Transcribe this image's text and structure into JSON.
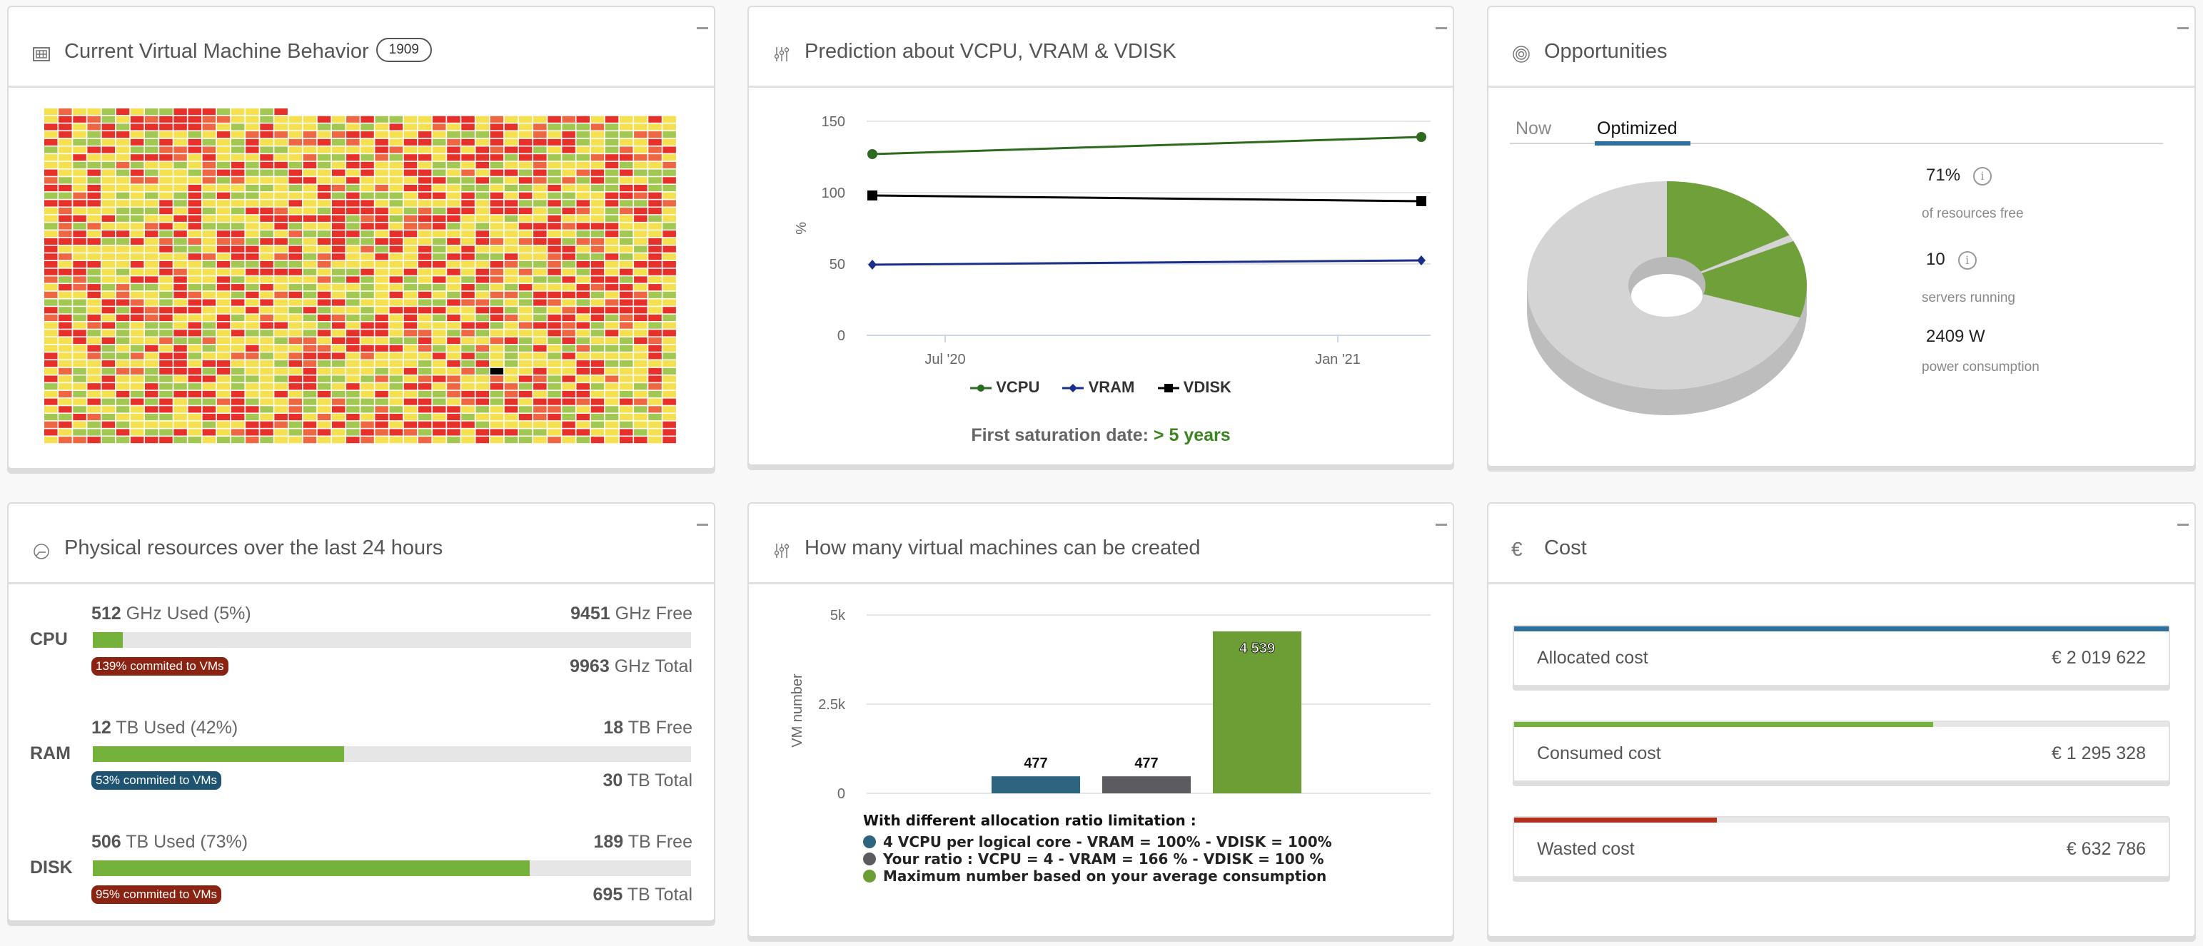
{
  "panels": {
    "vm_behavior": {
      "title": "Current Virtual Machine Behavior",
      "count_badge": "1909",
      "heatmap": {
        "total_cells": 1909,
        "columns": 44,
        "status_colors": {
          "ok": "#a2c852",
          "warning": "#f5e04f",
          "high": "#e8302a",
          "elevated": "#ee6742",
          "selected": "#000000"
        }
      }
    },
    "prediction": {
      "title": "Prediction about VCPU, VRAM & VDISK",
      "saturation_label": "First saturation date:",
      "saturation_value": "> 5 years"
    },
    "opportunities": {
      "title": "Opportunities",
      "tabs": [
        {
          "label": "Now",
          "active": false
        },
        {
          "label": "Optimized",
          "active": true
        }
      ],
      "stats": [
        {
          "value": "71%",
          "label": "of resources free",
          "has_info": true
        },
        {
          "value": "10",
          "label": "servers running",
          "has_info": true
        },
        {
          "value": "2409 W",
          "label": "power consumption",
          "has_info": false
        }
      ]
    },
    "physical": {
      "title": "Physical resources over the last 24 hours",
      "resources": [
        {
          "name": "CPU",
          "used_num": "512",
          "used_text": " GHz Used (5%)",
          "free_num": "9451",
          "free_text": " GHz Free",
          "total_num": "9963",
          "total_text": " GHz Total",
          "used_pct": 5,
          "committed": "139% commited to VMs",
          "committed_color": "#8b2312"
        },
        {
          "name": "RAM",
          "used_num": "12",
          "used_text": " TB Used (42%)",
          "free_num": "18",
          "free_text": " TB Free",
          "total_num": "30",
          "total_text": " TB Total",
          "used_pct": 42,
          "committed": "53% commited to VMs",
          "committed_color": "#1f5372"
        },
        {
          "name": "DISK",
          "used_num": "506",
          "used_text": " TB Used (73%)",
          "free_num": "189",
          "free_text": " TB Free",
          "total_num": "695",
          "total_text": " TB Total",
          "used_pct": 73,
          "committed": "95% commited to VMs",
          "committed_color": "#8b2312"
        }
      ]
    },
    "vm_capacity": {
      "title": "How many virtual machines can be created",
      "legend_title": "With different allocation ratio limitation :",
      "legend": [
        {
          "label": "4 VCPU per logical core - VRAM = 100% - VDISK = 100%",
          "color": "#2d6480"
        },
        {
          "label": "Your ratio : VCPU = 4 - VRAM = 166 % - VDISK = 100 %",
          "color": "#5c5c60"
        },
        {
          "label": "Maximum number based on your average consumption",
          "color": "#6c9e35"
        }
      ]
    },
    "cost": {
      "title": "Cost",
      "items": [
        {
          "label": "Allocated cost",
          "value": "€ 2 019 622",
          "fill_pct": 100,
          "color": "#2e6f9e"
        },
        {
          "label": "Consumed cost",
          "value": "€ 1 295 328",
          "fill_pct": 64,
          "color": "#74b23b"
        },
        {
          "label": "Wasted cost",
          "value": "€ 632 786",
          "fill_pct": 31,
          "color": "#b52d1c"
        }
      ]
    }
  },
  "chart_data": [
    {
      "type": "line",
      "title": "Prediction about VCPU, VRAM & VDISK",
      "xlabel": "",
      "ylabel": "%",
      "ylim": [
        0,
        150
      ],
      "yticks": [
        "0",
        "50",
        "100",
        "150"
      ],
      "xticks": [
        "Jul '20",
        "Jan '21"
      ],
      "x": [
        "start",
        "end"
      ],
      "grid": true,
      "legend": "bottom",
      "series": [
        {
          "name": "VCPU",
          "values": [
            127,
            139
          ],
          "color": "#2e6a1e",
          "marker": "circle"
        },
        {
          "name": "VRAM",
          "values": [
            49.5,
            52.5
          ],
          "color": "#1a2f8a",
          "marker": "diamond"
        },
        {
          "name": "VDISK",
          "values": [
            98,
            94
          ],
          "color": "#000000",
          "marker": "square"
        }
      ]
    },
    {
      "type": "bar",
      "title": "How many virtual machines can be created",
      "xlabel": "",
      "ylabel": "VM number",
      "ylim": [
        0,
        5000
      ],
      "yticks": [
        "0",
        "2.5k",
        "5k"
      ],
      "categories": [
        "4 VCPU per logical core",
        "Your ratio",
        "Maximum based on average consumption"
      ],
      "values": [
        477,
        477,
        4539
      ],
      "value_labels": [
        "477",
        "477",
        "4 539"
      ],
      "colors": [
        "#2d6480",
        "#5c5c60",
        "#6c9e35"
      ],
      "grid": true
    },
    {
      "type": "pie",
      "title": "Opportunities (Optimized)",
      "donut": true,
      "three_d": true,
      "slices": [
        {
          "name": "used-1",
          "value": 17,
          "color": "#6fa03a"
        },
        {
          "name": "gap",
          "value": 1,
          "color": "#d4d4d4"
        },
        {
          "name": "used-2",
          "value": 12,
          "color": "#6fa03a"
        },
        {
          "name": "free",
          "value": 70,
          "color": "#d4d4d4"
        }
      ]
    }
  ]
}
